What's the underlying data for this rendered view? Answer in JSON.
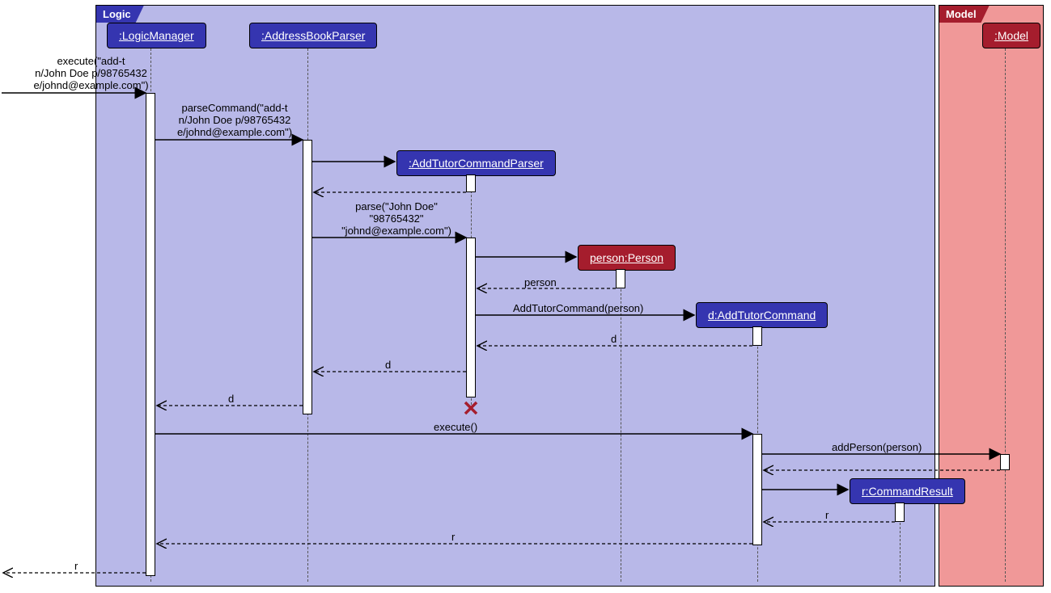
{
  "frames": {
    "logic": {
      "label": "Logic",
      "bg": "#b8b8e8",
      "labelBg": "#3535b0"
    },
    "model": {
      "label": "Model",
      "bg": "#f09898",
      "labelBg": "#a51d2d"
    }
  },
  "participants": {
    "logicManager": {
      "label": ":LogicManager",
      "bg": "#3535b0"
    },
    "addressBookParser": {
      "label": ":AddressBookParser",
      "bg": "#3535b0"
    },
    "addTutorCmdParser": {
      "label": ":AddTutorCommandParser",
      "bg": "#3535b0"
    },
    "person": {
      "label": "person:Person",
      "bg": "#a51d2d"
    },
    "addTutorCommand": {
      "label": "d:AddTutorCommand",
      "bg": "#3535b0"
    },
    "commandResult": {
      "label": "r:CommandResult",
      "bg": "#3535b0"
    },
    "model": {
      "label": ":Model",
      "bg": "#a51d2d"
    }
  },
  "messages": {
    "executeCall": "execute(\"add-t\nn/John Doe p/98765432\ne/johnd@example.com\")",
    "parseCommand": "parseCommand(\"add-t\nn/John Doe p/98765432\ne/johnd@example.com\")",
    "parse": "parse(\"John Doe\"\n\"98765432\"\n\"johnd@example.com\")",
    "personReturn": "person",
    "addTutorCmd": "AddTutorCommand(person)",
    "dReturn1": "d",
    "dReturn2": "d",
    "dReturn3": "d",
    "executeEmpty": "execute()",
    "addPerson": "addPerson(person)",
    "rReturn1": "r",
    "rReturn2": "r",
    "rReturn3": "r"
  }
}
